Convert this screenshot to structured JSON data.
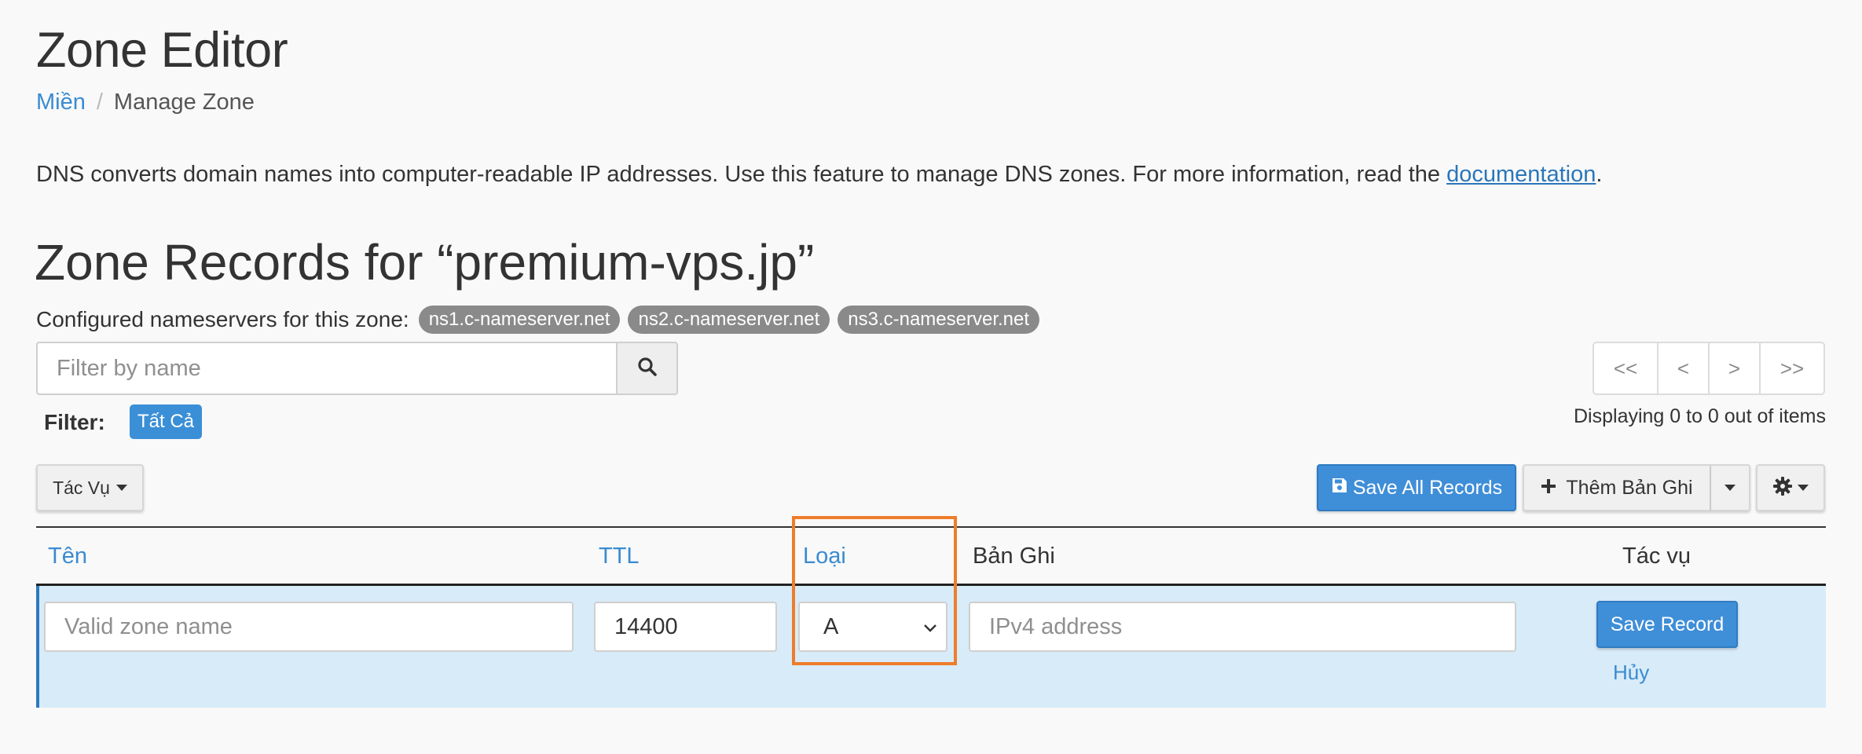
{
  "header": {
    "title": "Zone Editor"
  },
  "breadcrumb": {
    "parent": "Miền",
    "separator": "/",
    "current": "Manage Zone"
  },
  "intro": {
    "text": "DNS converts domain names into computer-readable IP addresses. Use this feature to manage DNS zones. For more information, read the ",
    "link": "documentation",
    "suffix": "."
  },
  "zone": {
    "heading": "Zone Records for “premium-vps.jp”",
    "nameservers_label": "Configured nameservers for this zone:",
    "nameservers": [
      "ns1.c-nameserver.net",
      "ns2.c-nameserver.net",
      "ns3.c-nameserver.net"
    ]
  },
  "search": {
    "placeholder": "Filter by name",
    "icon": "search-icon"
  },
  "pagination": {
    "first": "<<",
    "prev": "<",
    "next": ">",
    "last": ">>"
  },
  "filter": {
    "label": "Filter:",
    "active": "Tất Cả"
  },
  "display_count": "Displaying 0 to 0 out of items",
  "toolbar": {
    "actions_label": "Tác Vụ",
    "save_all_label": "Save All Records",
    "save_all_icon": "floppy-disk-icon",
    "add_record_label": "Thêm Bản Ghi",
    "add_icon": "plus-icon",
    "settings_icon": "gear-icon"
  },
  "table": {
    "columns": {
      "name": "Tên",
      "ttl": "TTL",
      "type": "Loại",
      "record": "Bản Ghi",
      "actions": "Tác vụ"
    },
    "new_row": {
      "name_placeholder": "Valid zone name",
      "ttl_value": "14400",
      "type_value": "A",
      "record_placeholder": "IPv4 address",
      "save_label": "Save Record",
      "cancel_label": "Hủy"
    }
  },
  "colors": {
    "accent": "#3f8ed8",
    "link": "#3a8bd1",
    "badge": "#8a8a8a",
    "row_highlight": "#d8ebf8",
    "annotation": "#ee7d2a"
  }
}
